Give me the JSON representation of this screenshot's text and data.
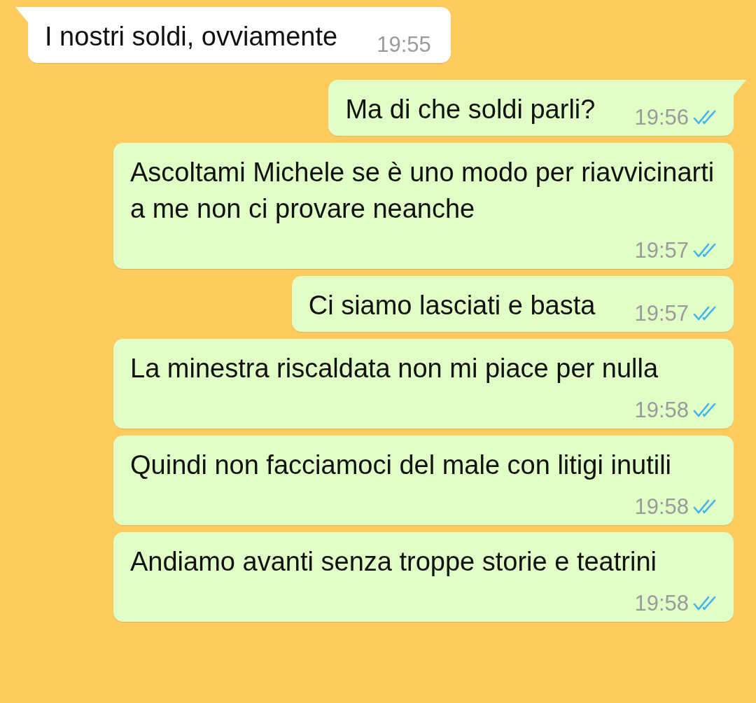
{
  "messages": [
    {
      "kind": "incoming",
      "tail": true,
      "text": "I nostri soldi, ovviamente",
      "time": "19:55"
    },
    {
      "kind": "outgoing",
      "tail": true,
      "text": "Ma di che soldi parli?",
      "time": "19:56",
      "read": true
    },
    {
      "kind": "outgoing",
      "tail": false,
      "text": "Ascoltami Michele se è uno modo per riavvicinarti a me non ci provare neanche",
      "time": "19:57",
      "read": true
    },
    {
      "kind": "outgoing",
      "tail": false,
      "text": "Ci siamo lasciati e basta",
      "time": "19:57",
      "read": true
    },
    {
      "kind": "outgoing",
      "tail": false,
      "text": "La minestra riscaldata non mi piace per nulla",
      "time": "19:58",
      "read": true
    },
    {
      "kind": "outgoing",
      "tail": false,
      "text": "Quindi non facciamoci del male con litigi inutili",
      "time": "19:58",
      "read": true
    },
    {
      "kind": "outgoing",
      "tail": false,
      "text": "Andiamo avanti senza troppe storie e teatrini",
      "time": "19:58",
      "read": true
    }
  ]
}
